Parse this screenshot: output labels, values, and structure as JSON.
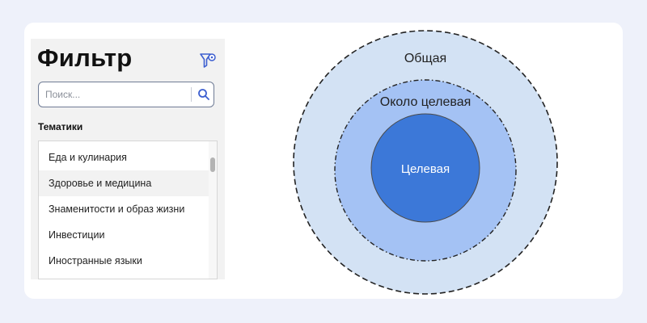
{
  "filter": {
    "title": "Фильтр",
    "filter_icon": "filter-settings-icon",
    "search": {
      "placeholder": "Поиск...",
      "value": "",
      "icon": "search-icon"
    },
    "topics_label": "Тематики",
    "topics": [
      "Еда и кулинария",
      "Здоровье и медицина",
      "Знаменитости и образ жизни",
      "Инвестиции",
      "Иностранные языки"
    ],
    "highlighted_topic_index": 1
  },
  "diagram": {
    "outer_label": "Общая",
    "middle_label": "Около целевая",
    "inner_label": "Целевая",
    "colors": {
      "outer": "#d3e2f4",
      "middle": "#a4c2f4",
      "inner": "#3c78d8",
      "accent": "#3d5fd0"
    }
  }
}
